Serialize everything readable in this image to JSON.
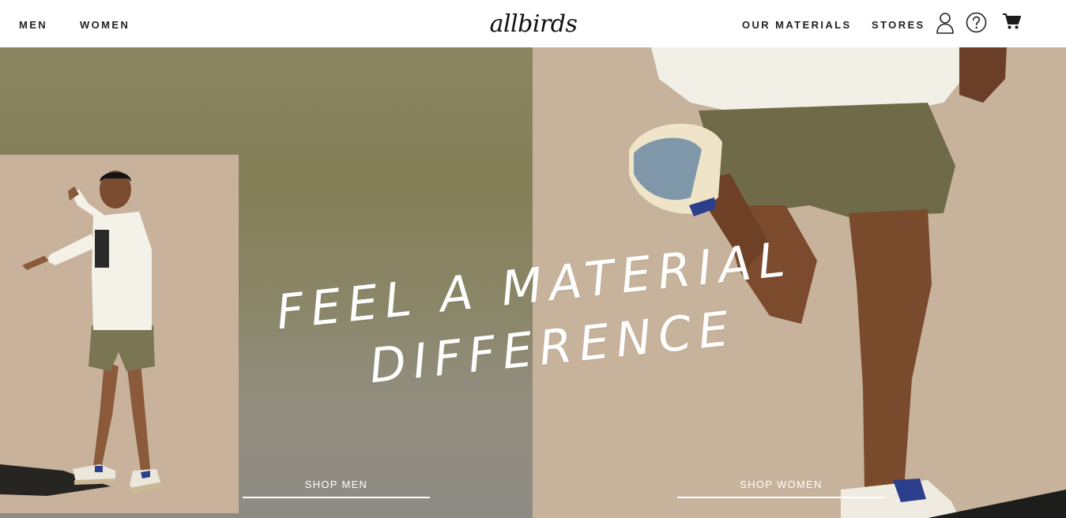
{
  "header": {
    "nav_left": [
      "MEN",
      "WOMEN"
    ],
    "logo_text": "allbirds",
    "nav_right": [
      "OUR MATERIALS",
      "STORES"
    ],
    "icons": [
      "account-icon",
      "help-icon",
      "cart-icon"
    ]
  },
  "hero": {
    "headline_line1": "FEEL A MATERIAL",
    "headline_line2": "DIFFERENCE",
    "cta_men": "SHOP MEN",
    "cta_women": "SHOP WOMEN"
  },
  "colors": {
    "left_panel": "#857f58",
    "right_panel": "#c7b29c",
    "inset_bg": "#c8b29c",
    "text_dark": "#212121",
    "cta_text": "#ffffff"
  }
}
